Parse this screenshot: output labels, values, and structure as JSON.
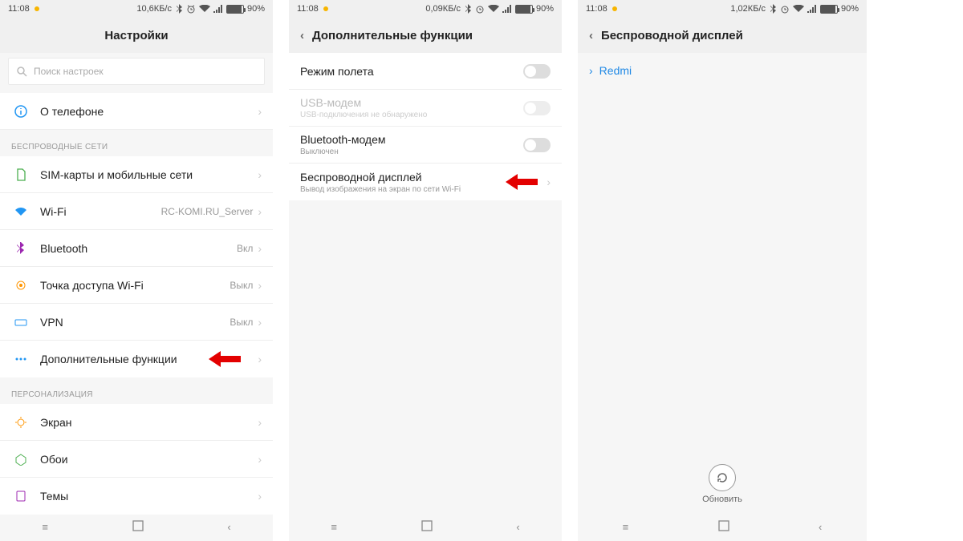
{
  "status": {
    "time": "11:08",
    "battery": "90%"
  },
  "screen1": {
    "net": "10,6КБ/с",
    "title": "Настройки",
    "search_ph": "Поиск настроек",
    "about": "О телефоне",
    "sec_wireless": "БЕСПРОВОДНЫЕ СЕТИ",
    "sim": "SIM-карты и мобильные сети",
    "wifi": "Wi-Fi",
    "wifi_val": "RC-KOMI.RU_Server",
    "bt": "Bluetooth",
    "bt_val": "Вкл",
    "hotspot": "Точка доступа Wi-Fi",
    "hotspot_val": "Выкл",
    "vpn": "VPN",
    "vpn_val": "Выкл",
    "more": "Дополнительные функции",
    "sec_pers": "ПЕРСОНАЛИЗАЦИЯ",
    "display": "Экран",
    "wallpaper": "Обои",
    "themes": "Темы"
  },
  "screen2": {
    "net": "0,09КБ/с",
    "title": "Дополнительные функции",
    "airplane": "Режим полета",
    "usb": "USB-модем",
    "usb_sub": "USB-подключения не обнаружено",
    "btm": "Bluetooth-модем",
    "btm_sub": "Выключен",
    "cast": "Беспроводной дисплей",
    "cast_sub": "Вывод изображения на экран по сети Wi-Fi"
  },
  "screen3": {
    "net": "1,02КБ/с",
    "title": "Беспроводной дисплей",
    "device": "Redmi",
    "refresh": "Обновить"
  }
}
